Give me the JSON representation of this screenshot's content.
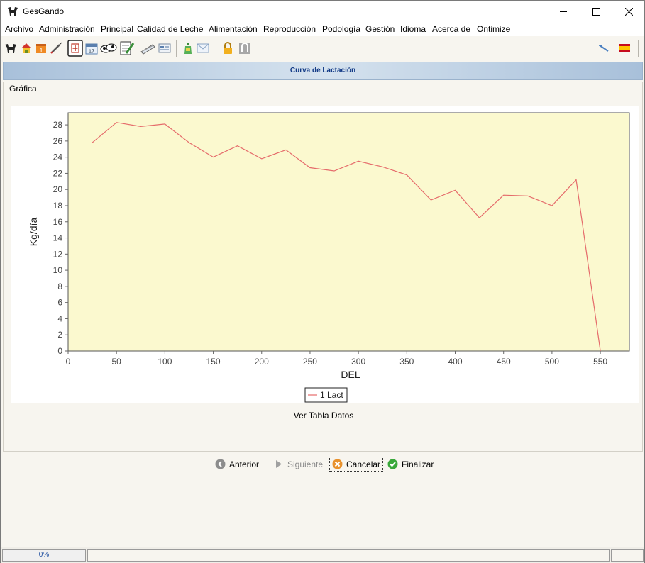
{
  "window": {
    "title": "GesGando",
    "minimize_icon": "minimize-icon",
    "maximize_icon": "maximize-icon",
    "close_icon": "close-icon"
  },
  "menu": [
    "Archivo",
    "Administración",
    "Principal",
    "Calidad de Leche",
    "Alimentación",
    "Reproducción",
    "Podología",
    "Gestión",
    "Idioma",
    "Acerca de",
    "Ontimize"
  ],
  "toolbar_icons": [
    "cow-icon",
    "farm-icon",
    "calendar-one-icon",
    "syringe-icon",
    "medical-icon",
    "calendar-17-icon",
    "cows-icon",
    "notepad-pencil-icon",
    "pen-write-icon",
    "form-icon",
    "bottle-icon",
    "envelope-icon",
    "lock-icon",
    "gate-icon",
    "resize-icon",
    "spain-flag-icon"
  ],
  "header": {
    "title": "Curva de Lactación",
    "accent": "#123a86"
  },
  "panel": {
    "title": "Gráfica",
    "view_table_label": "Ver Tabla Datos"
  },
  "nav": {
    "prev_label": "Anterior",
    "next_label": "Siguiente",
    "cancel_label": "Cancelar",
    "finish_label": "Finalizar"
  },
  "status": {
    "progress_text": "0%",
    "progress_value": 0
  },
  "chart_data": {
    "type": "line",
    "title": "",
    "xlabel": "DEL",
    "ylabel": "Kg/día",
    "xlim": [
      0,
      580
    ],
    "ylim": [
      0,
      29.5
    ],
    "xticks": [
      0,
      50,
      100,
      150,
      200,
      250,
      300,
      350,
      400,
      450,
      500,
      550
    ],
    "yticks": [
      0,
      2,
      4,
      6,
      8,
      10,
      12,
      14,
      16,
      18,
      20,
      22,
      24,
      26,
      28
    ],
    "plot_background": "#fbf9cf",
    "grid": false,
    "legend_position": "bottom",
    "series": [
      {
        "name": "1 Lact",
        "color": "#e56b6b",
        "x": [
          25,
          50,
          75,
          100,
          125,
          150,
          175,
          200,
          225,
          250,
          275,
          300,
          325,
          350,
          375,
          400,
          425,
          450,
          475,
          500,
          525,
          550
        ],
        "y": [
          25.8,
          28.3,
          27.8,
          28.1,
          25.8,
          24.0,
          25.4,
          23.8,
          24.9,
          22.7,
          22.3,
          23.5,
          22.8,
          21.8,
          18.7,
          19.9,
          16.5,
          19.3,
          19.2,
          18.0,
          21.2,
          0.0
        ]
      }
    ]
  }
}
